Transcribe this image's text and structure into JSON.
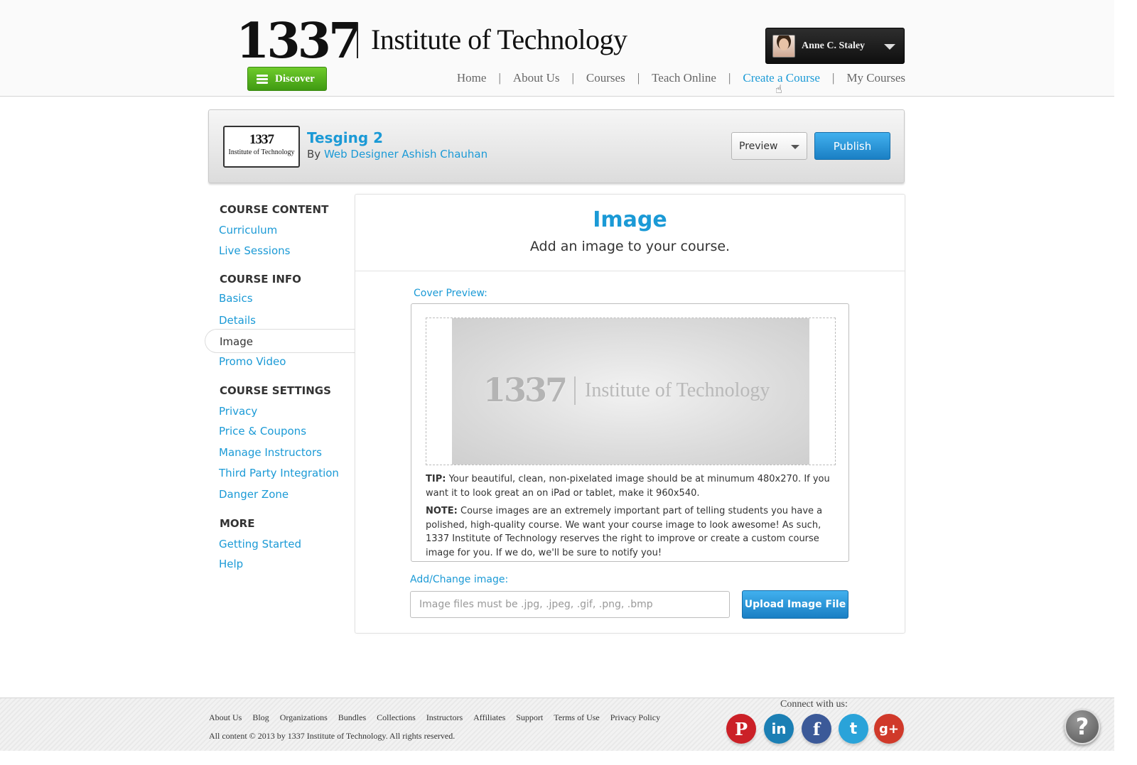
{
  "header": {
    "logo_number": "1337",
    "logo_text": "Institute of Technology",
    "discover_label": "Discover",
    "nav": [
      "Home",
      "About Us",
      "Courses",
      "Teach Online",
      "Create a Course",
      "My Courses"
    ],
    "nav_active": "Create a Course",
    "user_name": "Anne C. Staley"
  },
  "course": {
    "thumb_number": "1337",
    "thumb_text": "Institute of Technology",
    "title": "Tesging 2",
    "by_label": "By",
    "author": "Web Designer Ashish Chauhan",
    "preview_label": "Preview",
    "publish_label": "Publish"
  },
  "sidebar": {
    "course_content_heading": "COURSE CONTENT",
    "curriculum": "Curriculum",
    "live_sessions": "Live Sessions",
    "course_info_heading": "COURSE INFO",
    "basics": "Basics",
    "details": "Details",
    "image": "Image",
    "promo_video": "Promo Video",
    "course_settings_heading": "COURSE SETTINGS",
    "privacy": "Privacy",
    "price_coupons": "Price & Coupons",
    "manage_instructors": "Manage Instructors",
    "third_party": "Third Party Integration",
    "danger_zone": "Danger Zone",
    "more_heading": "MORE",
    "getting_started": "Getting Started",
    "help": "Help"
  },
  "main": {
    "title": "Image",
    "subtitle": "Add an image to your course.",
    "cover_label": "Cover Preview:",
    "cover_number": "1337",
    "cover_text": "Institute of Technology",
    "tip_label": "TIP:",
    "tip_text": "Your beautiful, clean, non-pixelated image should be at minumum 480x270. If you want it to look great an on iPad or tablet, make it 960x540.",
    "note_label": "NOTE:",
    "note_text": "Course images are an extremely important part of telling students you have a polished, high-quality course. We want your course image to look awesome! As such, 1337 Institute of Technology reserves the right to improve or create a custom course image for you. If we do, we'll be sure to notify you!",
    "add_label": "Add/Change image:",
    "file_placeholder": "Image files must be .jpg, .jpeg, .gif, .png, .bmp",
    "upload_label": "Upload Image File"
  },
  "footer": {
    "links": [
      "About Us",
      "Blog",
      "Organizations",
      "Bundles",
      "Collections",
      "Instructors",
      "Affiliates",
      "Support",
      "Terms of Use",
      "Privacy Policy"
    ],
    "copyright": "All content © 2013 by 1337 Institute of Technology. All rights reserved.",
    "connect_label": "Connect with us:",
    "social": [
      {
        "name": "pinterest-icon",
        "glyph": "P",
        "color": "#cb2027"
      },
      {
        "name": "linkedin-icon",
        "glyph": "in",
        "color": "#1b7fb4"
      },
      {
        "name": "facebook-icon",
        "glyph": "f",
        "color": "#3b5998"
      },
      {
        "name": "twitter-icon",
        "glyph": "t",
        "color": "#2aa3d9"
      },
      {
        "name": "google-plus-icon",
        "glyph": "g+",
        "color": "#d0392a"
      }
    ],
    "help_glyph": "?"
  },
  "colors": {
    "accent": "#1b9ad6",
    "discover_green": "#4faf1b",
    "publish_blue": "#2394d8"
  }
}
